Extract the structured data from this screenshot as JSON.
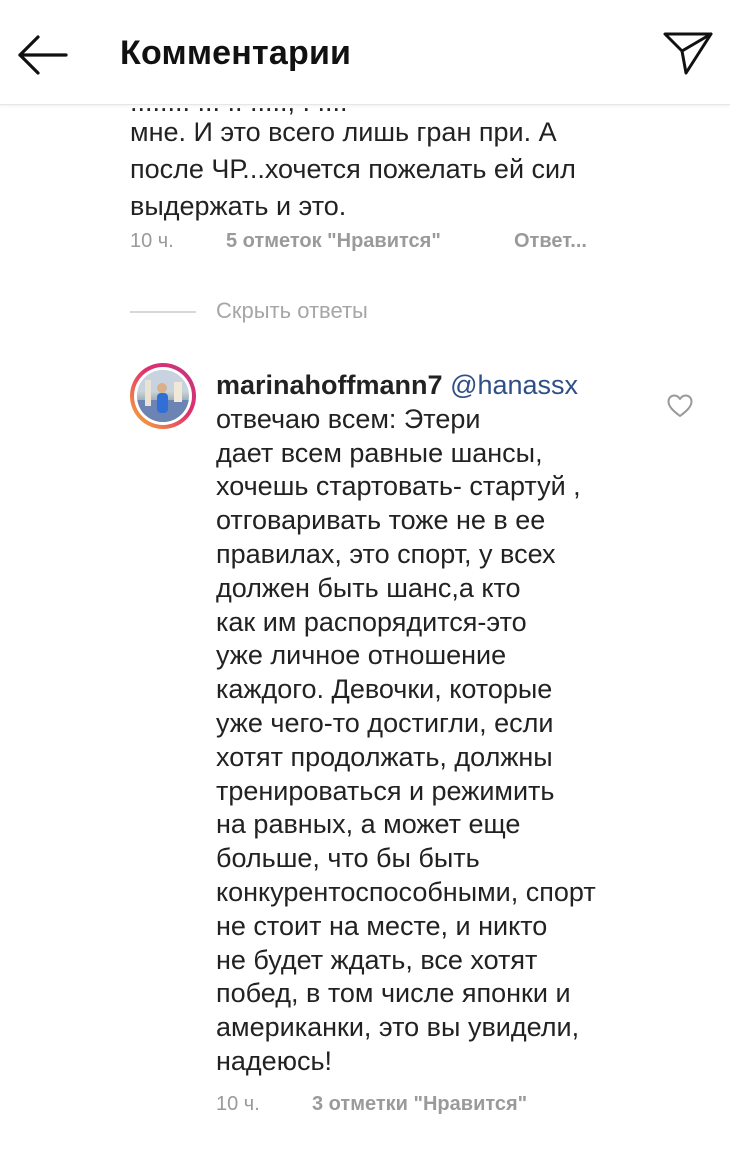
{
  "header": {
    "title": "Комментарии",
    "back_icon": "arrow-left-icon",
    "send_icon": "paper-plane-icon"
  },
  "parent_comment": {
    "cut_line": "........ ... .. ....., . ....",
    "lines": [
      "мне. И это всего лишь гран при. А",
      "после ЧР...хочется пожелать ей сил",
      "выдержать и это."
    ],
    "time": "10 ч.",
    "likes": "5 отметок \"Нравится\"",
    "reply": "Ответ..."
  },
  "hide_replies": "Скрыть ответы",
  "reply_comment": {
    "username": "marinahoffmann7",
    "mention": "@hanassx",
    "first_line": "отвечаю всем: Этери",
    "lines": [
      "дает всем равные шансы,",
      "хочешь стартовать- стартуй ,",
      "отговаривать тоже не в ее",
      "правилах, это спорт, у всех",
      "должен быть шанс,а кто",
      "как им распорядится-это",
      "уже личное отношение",
      "каждого. Девочки, которые",
      "уже чего-то достигли, если",
      "хотят продолжать, должны",
      "тренироваться и режимить",
      "на равных, а может еще",
      "больше, что бы быть",
      "конкурентоспособными, спорт",
      "не стоит на месте, и никто",
      "не будет ждать, все хотят",
      "побед, в том числе японки и",
      "американки, это вы увидели,",
      "надеюсь!"
    ],
    "time": "10 ч.",
    "likes": "3 отметки \"Нравится\"",
    "like_icon": "heart-outline-icon"
  },
  "colors": {
    "text": "#222222",
    "meta": "#9a9a9a",
    "mention": "#2f4f86",
    "avatar_ring": "#e1306c"
  }
}
